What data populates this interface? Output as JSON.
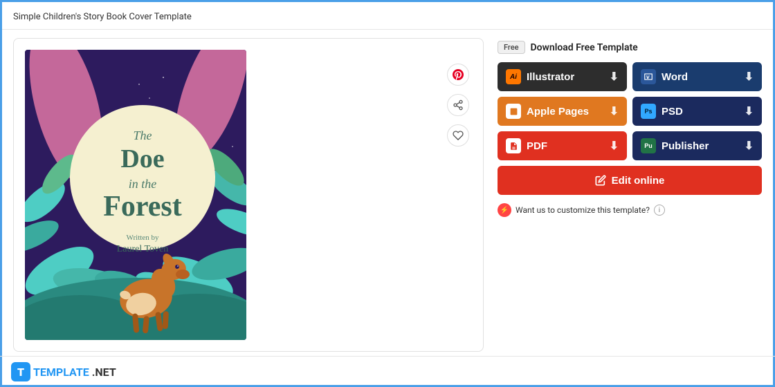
{
  "header": {
    "title": "Simple Children's Story Book Cover Template"
  },
  "preview": {
    "book": {
      "title_line1": "The",
      "title_line2": "Doe",
      "title_line3": "in the",
      "title_line4": "Forest",
      "written_by": "Written by",
      "author": "Laurel Toven"
    }
  },
  "actions": {
    "pinterest_icon": "pinterest",
    "share_icon": "share",
    "heart_icon": "heart"
  },
  "download": {
    "free_label": "Free",
    "section_label": "Download Free Template",
    "illustrator_label": "Illustrator",
    "word_label": "Word",
    "apple_pages_label": "Apple Pages",
    "psd_label": "PSD",
    "pdf_label": "PDF",
    "publisher_label": "Publisher",
    "edit_online_label": "Edit online",
    "customize_text": "Want us to customize this template?",
    "info_tooltip": "i"
  },
  "footer": {
    "logo_letter": "T",
    "brand_name": "TEMPLATE",
    "brand_suffix": ".NET"
  }
}
